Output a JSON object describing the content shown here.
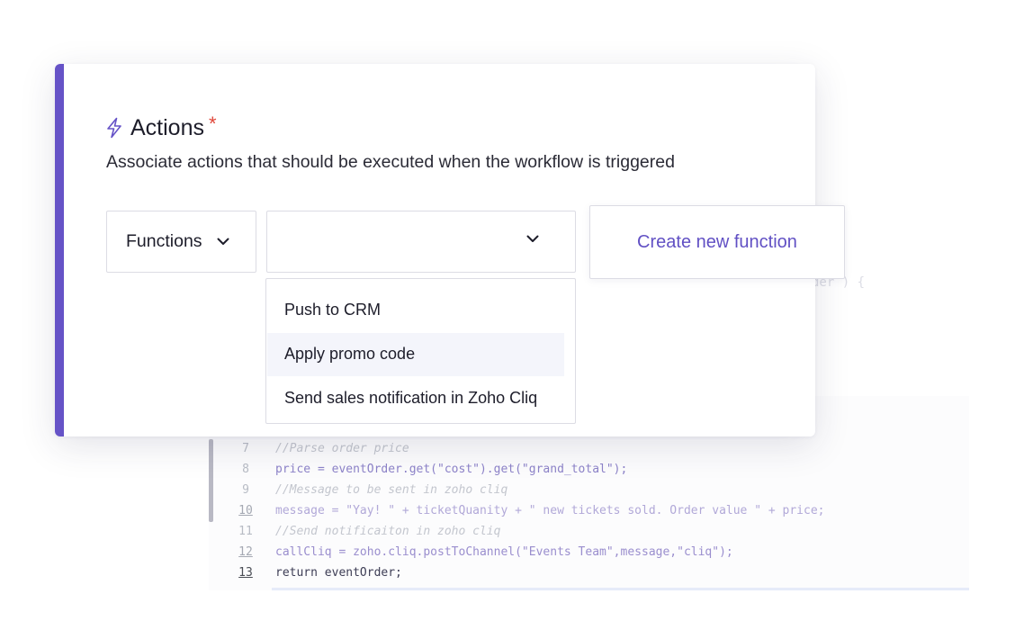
{
  "actions_panel": {
    "title": "Actions",
    "required_marker": "*",
    "description": "Associate actions that should be executed when the workflow is triggered",
    "type_select": {
      "value": "Functions"
    },
    "function_select": {
      "value": ""
    },
    "create_button_label": "Create new function",
    "dropdown_options": [
      {
        "label": "Push to CRM",
        "highlighted": false
      },
      {
        "label": "Apply promo code",
        "highlighted": true
      },
      {
        "label": "Send sales notification in Zoho Cliq",
        "highlighted": false
      }
    ]
  },
  "code_editor": {
    "partial_fragment": "der ) {",
    "lines": [
      {
        "number": "7",
        "underlined": false,
        "text": "//Parse order price"
      },
      {
        "number": "8",
        "underlined": false,
        "text": "price = eventOrder.get(\"cost\").get(\"grand_total\");"
      },
      {
        "number": "9",
        "underlined": false,
        "text": "//Message to be sent in zoho cliq"
      },
      {
        "number": "10",
        "underlined": true,
        "text": "message = \"Yay! \" + ticketQuanity + \" new tickets sold. Order value \" + price;"
      },
      {
        "number": "11",
        "underlined": false,
        "text": "//Send notificaiton in zoho cliq"
      },
      {
        "number": "12",
        "underlined": true,
        "text": "callCliq = zoho.cliq.postToChannel(\"Events Team\",message,\"cliq\");"
      },
      {
        "number": "13",
        "underlined": true,
        "text": "return eventOrder;"
      }
    ]
  },
  "colors": {
    "accent": "#6653c7",
    "link": "#6150c4",
    "required": "#e0483b"
  },
  "icons": {
    "title": "lightning-bolt-icon",
    "select": "chevron-down-icon"
  }
}
